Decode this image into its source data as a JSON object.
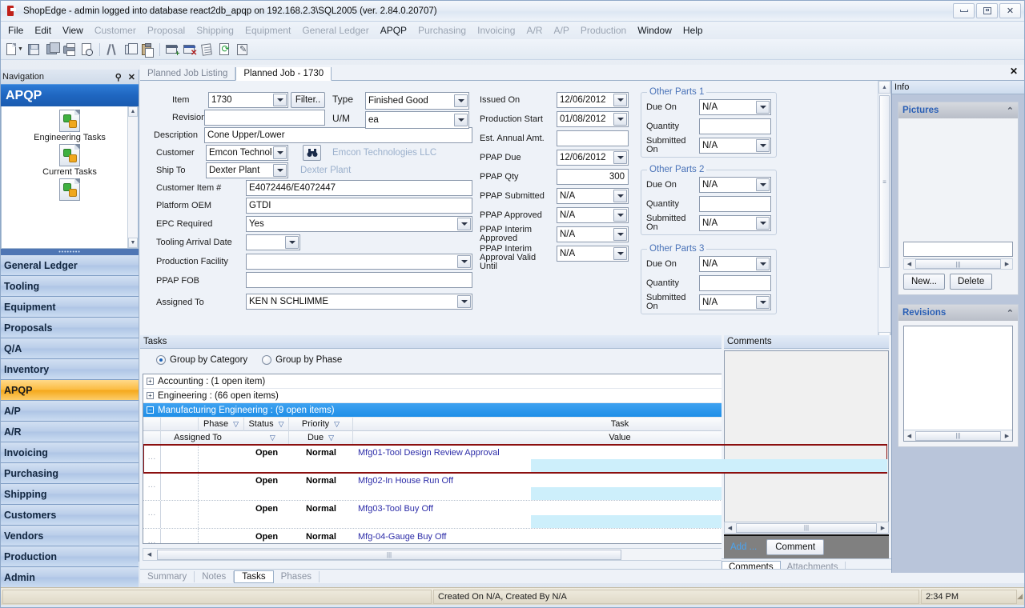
{
  "window": {
    "title": "ShopEdge - admin logged into database react2db_apqp on 192.168.2.3\\SQL2005 (ver. 2.84.0.20707)",
    "minimize": "–",
    "maximize": "□",
    "close": "✕"
  },
  "menu": [
    {
      "label": "File",
      "enabled": true
    },
    {
      "label": "Edit",
      "enabled": true
    },
    {
      "label": "View",
      "enabled": true
    },
    {
      "label": "Customer",
      "enabled": false
    },
    {
      "label": "Proposal",
      "enabled": false
    },
    {
      "label": "Shipping",
      "enabled": false
    },
    {
      "label": "Equipment",
      "enabled": false
    },
    {
      "label": "General Ledger",
      "enabled": false
    },
    {
      "label": "APQP",
      "enabled": true
    },
    {
      "label": "Purchasing",
      "enabled": false
    },
    {
      "label": "Invoicing",
      "enabled": false
    },
    {
      "label": "A/R",
      "enabled": false
    },
    {
      "label": "A/P",
      "enabled": false
    },
    {
      "label": "Production",
      "enabled": false
    },
    {
      "label": "Window",
      "enabled": true
    },
    {
      "label": "Help",
      "enabled": true
    }
  ],
  "toolbar": {
    "buttons": [
      "new-document-icon",
      "dropdown-caret-icon",
      "save-icon",
      "save-all-icon",
      "print-icon",
      "print-preview-icon",
      "cut-icon",
      "copy-icon",
      "paste-icon",
      "add-record-icon",
      "delete-record-icon",
      "notes-icon",
      "refresh-icon",
      "edit-icon"
    ]
  },
  "navigation": {
    "header": "Navigation",
    "pin_icon": "pin-icon",
    "close_icon": "close-icon",
    "active_group": "APQP",
    "shortcuts": [
      {
        "label": "Engineering Tasks",
        "icon": "apqp-task-icon"
      },
      {
        "label": "Current Tasks",
        "icon": "apqp-task-icon"
      }
    ],
    "items": [
      {
        "label": "General Ledger",
        "active": false
      },
      {
        "label": "Tooling",
        "active": false
      },
      {
        "label": "Equipment",
        "active": false
      },
      {
        "label": "Proposals",
        "active": false
      },
      {
        "label": "Q/A",
        "active": false
      },
      {
        "label": "Inventory",
        "active": false
      },
      {
        "label": "APQP",
        "active": true
      },
      {
        "label": "A/P",
        "active": false
      },
      {
        "label": "A/R",
        "active": false
      },
      {
        "label": "Invoicing",
        "active": false
      },
      {
        "label": "Purchasing",
        "active": false
      },
      {
        "label": "Shipping",
        "active": false
      },
      {
        "label": "Customers",
        "active": false
      },
      {
        "label": "Vendors",
        "active": false
      },
      {
        "label": "Production",
        "active": false
      },
      {
        "label": "Admin",
        "active": false
      }
    ],
    "overflow": "»"
  },
  "doc_tabs": [
    {
      "label": "Planned Job Listing",
      "active": false
    },
    {
      "label": "Planned Job - 1730",
      "active": true
    }
  ],
  "doc_tab_close": "✕",
  "form": {
    "left_column": [
      {
        "label": "Item",
        "value": "1730",
        "type": "combo"
      },
      {
        "label": "Revision",
        "value": "",
        "type": "text"
      },
      {
        "label": "Description",
        "value": "Cone Upper/Lower",
        "type": "text"
      },
      {
        "label": "Customer",
        "value": "Emcon Technologi",
        "type": "combo-lookup",
        "ghost": "Emcon Technologies LLC"
      },
      {
        "label": "Ship To",
        "value": "Dexter Plant",
        "type": "combo",
        "ghost": "Dexter Plant"
      },
      {
        "label": "Customer Item #",
        "value": "E4072446/E4072447",
        "type": "text"
      },
      {
        "label": "Platform OEM",
        "value": "GTDI",
        "type": "text"
      },
      {
        "label": "EPC Required",
        "value": "Yes",
        "type": "combo"
      },
      {
        "label": "Tooling Arrival Date",
        "value": "",
        "type": "date"
      },
      {
        "label": "Production Facility",
        "value": "",
        "type": "combo"
      },
      {
        "label": "PPAP FOB",
        "value": "",
        "type": "text"
      },
      {
        "label": "Assigned To",
        "value": "KEN N SCHLIMME",
        "type": "combo"
      }
    ],
    "filter_button": "Filter..",
    "lookup_icon": "binoculars-icon",
    "type_field": {
      "label": "Type",
      "value": "Finished Good"
    },
    "um_field": {
      "label": "U/M",
      "value": "ea"
    },
    "middle_column": [
      {
        "label": "Issued On",
        "value": "12/06/2012",
        "type": "date"
      },
      {
        "label": "Production Start",
        "value": "01/08/2012",
        "type": "date"
      },
      {
        "label": "Est. Annual Amt.",
        "value": "",
        "type": "text"
      },
      {
        "label": "PPAP Due",
        "value": "12/06/2012",
        "type": "date"
      },
      {
        "label": "PPAP Qty",
        "value": "300",
        "type": "number"
      },
      {
        "label": "PPAP Submitted",
        "value": "N/A",
        "type": "date"
      },
      {
        "label": "PPAP Approved",
        "value": "N/A",
        "type": "date"
      },
      {
        "label": "PPAP Interim Approved",
        "value": "N/A",
        "type": "date"
      },
      {
        "label": "PPAP Interim Approval Valid Until",
        "value": "N/A",
        "type": "date"
      }
    ],
    "other_parts": [
      {
        "title": "Other Parts 1",
        "rows": [
          {
            "label": "Due On",
            "value": "N/A",
            "type": "date"
          },
          {
            "label": "Quantity",
            "value": "",
            "type": "text"
          },
          {
            "label": "Submitted On",
            "value": "N/A",
            "type": "date"
          }
        ]
      },
      {
        "title": "Other Parts 2",
        "rows": [
          {
            "label": "Due On",
            "value": "N/A",
            "type": "date"
          },
          {
            "label": "Quantity",
            "value": "",
            "type": "text"
          },
          {
            "label": "Submitted On",
            "value": "N/A",
            "type": "date"
          }
        ]
      },
      {
        "title": "Other Parts 3",
        "rows": [
          {
            "label": "Due On",
            "value": "N/A",
            "type": "date"
          },
          {
            "label": "Quantity",
            "value": "",
            "type": "text"
          },
          {
            "label": "Submitted On",
            "value": "N/A",
            "type": "date"
          }
        ]
      }
    ]
  },
  "tasks": {
    "title": "Tasks",
    "group_options": [
      {
        "label": "Group by Category",
        "selected": true
      },
      {
        "label": "Group by Phase",
        "selected": false
      }
    ],
    "groups": [
      {
        "label": "Accounting : (1 open item)",
        "expanded": false,
        "selected": false
      },
      {
        "label": "Engineering : (66 open items)",
        "expanded": false,
        "selected": false
      },
      {
        "label": "Manufacturing Engineering : (9 open items)",
        "expanded": true,
        "selected": true
      }
    ],
    "headers_row1": [
      "Phase",
      "Status",
      "Priority",
      "Task"
    ],
    "headers_row2": [
      "Assigned To",
      "Due",
      "Value"
    ],
    "rows": [
      {
        "assigned_to": "",
        "phase": "",
        "status": "Open",
        "priority": "Normal",
        "task": "Mfg01-Tool Design Review Approval",
        "due": "",
        "value": "",
        "highlight": true
      },
      {
        "assigned_to": "",
        "phase": "",
        "status": "Open",
        "priority": "Normal",
        "task": "Mfg02-In House Run Off",
        "due": "",
        "value": "",
        "highlight": false
      },
      {
        "assigned_to": "",
        "phase": "",
        "status": "Open",
        "priority": "Normal",
        "task": "Mfg03-Tool Buy Off",
        "due": "",
        "value": "",
        "highlight": false
      },
      {
        "assigned_to": "",
        "phase": "",
        "status": "Open",
        "priority": "Normal",
        "task": "Mfg-04-Gauge Buy Off",
        "due": "",
        "value": "",
        "highlight": false
      }
    ]
  },
  "comments": {
    "title": "Comments",
    "add_label": "Add ...",
    "comment_button": "Comment",
    "tabs": [
      {
        "label": "Comments",
        "active": true
      },
      {
        "label": "Attachments",
        "active": false
      }
    ]
  },
  "info": {
    "header": "Info",
    "cards": [
      {
        "title": "Pictures",
        "collapse_icon": "chevron-up-icon",
        "buttons": [
          "New...",
          "Delete"
        ]
      },
      {
        "title": "Revisions",
        "collapse_icon": "chevron-up-icon",
        "buttons": []
      }
    ]
  },
  "lower_tabs": [
    {
      "label": "Summary",
      "active": false
    },
    {
      "label": "Notes",
      "active": false
    },
    {
      "label": "Tasks",
      "active": true
    },
    {
      "label": "Phases",
      "active": false
    }
  ],
  "status_bar": {
    "message": "Created On N/A, Created By N/A",
    "time": "2:34 PM"
  },
  "colors": {
    "accent_blue": "#1f66c0",
    "active_orange": "#f5a81b",
    "selected_row": "#1f8fe8",
    "highlight_outline": "#8b0f0f",
    "link_text": "#2c2ca8"
  }
}
